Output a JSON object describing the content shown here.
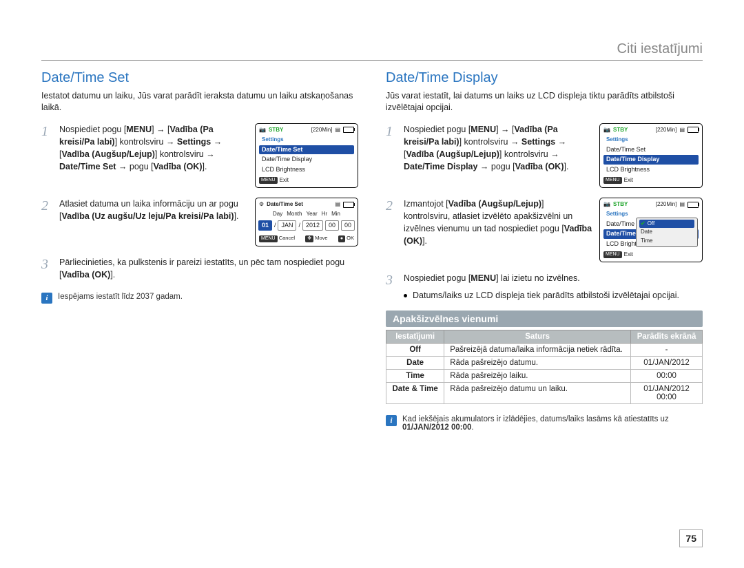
{
  "section": "Citi iestatījumi",
  "page_number": "75",
  "left": {
    "title": "Date/Time Set",
    "intro": "Iestatot datumu un laiku, Jūs varat parādīt ieraksta datumu un laiku atskaņošanas laikā.",
    "steps": {
      "s1": {
        "num": "1",
        "t1": "Nospiediet pogu [",
        "menu": "MENU",
        "t2": "] → [",
        "b1": "Vadība (Pa kreisi/Pa labi)",
        "t3": "] kontrolsviru → ",
        "b2": "Settings",
        "t4": " → [",
        "b3": "Vadība (Augšup/Lejup)",
        "t5": "] kontrolsviru → ",
        "b4": "Date/Time Set",
        "t6": " → pogu [",
        "b5": "Vadība (OK)",
        "t7": "]."
      },
      "s2": {
        "num": "2",
        "t1": "Atlasiet datuma un laika informāciju un ar pogu [",
        "b1": "Vadība (Uz augšu/Uz leju/Pa kreisi/Pa labi)",
        "t2": "]."
      },
      "s3": {
        "num": "3",
        "t1": "Pārliecinieties, ka pulkstenis ir pareizi iestatīts, un pēc tam nospiediet pogu [",
        "b1": "Vadība (OK)",
        "t2": "]."
      }
    },
    "lcd1": {
      "stby": "STBY",
      "remain": "[220Min]",
      "settings_label": "Settings",
      "row_sel": "Date/Time Set",
      "row2": "Date/Time Display",
      "row3": "LCD Brightness",
      "exit": "Exit",
      "menu_tag": "MENU"
    },
    "lcd2": {
      "title": "Date/Time Set",
      "labels": {
        "d": "Day",
        "m": "Month",
        "y": "Year",
        "h": "Hr",
        "mi": "Min"
      },
      "vals": {
        "d": "01",
        "sep": "/",
        "m": "JAN",
        "y": "2012",
        "h": "00",
        "mi": "00"
      },
      "cancel": "Cancel",
      "move": "Move",
      "ok": "OK",
      "menu_tag": "MENU"
    },
    "note": "Iespējams iestatīt līdz 2037 gadam."
  },
  "right": {
    "title": "Date/Time Display",
    "intro": "Jūs varat iestatīt, lai datums un laiks uz LCD displeja tiktu parādīts atbilstoši izvēlētajai opcijai.",
    "steps": {
      "s1": {
        "num": "1",
        "t1": "Nospiediet pogu [",
        "menu": "MENU",
        "t2": "] → [",
        "b1": "Vadība (Pa kreisi/Pa labi)",
        "t3": "] kontrolsviru → ",
        "b2": "Settings",
        "t4": " → [",
        "b3": "Vadība (Augšup/Lejup)",
        "t5": "] kontrolsviru → ",
        "b4": "Date/Time Display",
        "t6": " → pogu [",
        "b5": "Vadība (OK)",
        "t7": "]."
      },
      "s2": {
        "num": "2",
        "t1": "Izmantojot [",
        "b1": "Vadība (Augšup/Lejup)",
        "t2": "] kontrolsviru, atlasiet izvēlēto apakšizvēlni un izvēlnes vienumu un tad nospiediet pogu [",
        "b2": "Vadība (OK)",
        "t3": "]."
      },
      "s3": {
        "num": "3",
        "t1": "Nospiediet pogu [",
        "menu": "MENU",
        "t2": "] lai izietu no izvēlnes."
      }
    },
    "bullet": "Datums/laiks uz LCD displeja tiek parādīts atbilstoši izvēlētajai opcijai.",
    "lcd1": {
      "stby": "STBY",
      "remain": "[220Min]",
      "settings_label": "Settings",
      "row1": "Date/Time Set",
      "row_sel": "Date/Time Display",
      "row3": "LCD Brightness",
      "exit": "Exit",
      "menu_tag": "MENU"
    },
    "lcd2": {
      "stby": "STBY",
      "remain": "[220Min]",
      "settings_label": "Settings",
      "row1": "Date/Time Set",
      "row_sel": "Date/Time Display",
      "row3": "LCD Brightness",
      "pop": {
        "off": "Off",
        "date": "Date",
        "time": "Time"
      },
      "exit": "Exit",
      "menu_tag": "MENU"
    },
    "sub_heading": "Apakšizvēlnes vienumi",
    "table": {
      "h1": "Iestatījumi",
      "h2": "Saturs",
      "h3": "Parādīts ekrānā",
      "r1": {
        "c1": "Off",
        "c2": "Pašreizējā datuma/laika informācija netiek rādīta.",
        "c3": "-"
      },
      "r2": {
        "c1": "Date",
        "c2": "Rāda pašreizējo datumu.",
        "c3": "01/JAN/2012"
      },
      "r3": {
        "c1": "Time",
        "c2": "Rāda pašreizējo laiku.",
        "c3": "00:00"
      },
      "r4": {
        "c1": "Date & Time",
        "c2": "Rāda pašreizējo datumu un laiku.",
        "c3": "01/JAN/2012\n00:00"
      }
    },
    "note_pre": "Kad iekšējais akumulators ir izlādējies, datums/laiks lasāms kā atiestatīts uz ",
    "note_bold": "01/JAN/2012 00:00",
    "note_post": "."
  }
}
